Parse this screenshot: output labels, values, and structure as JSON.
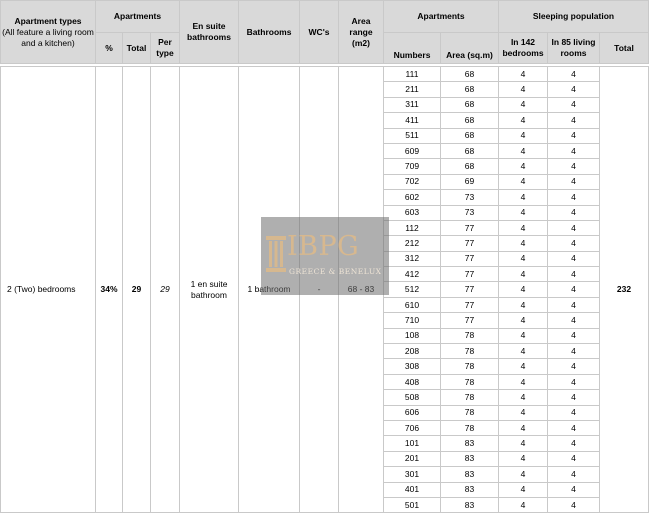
{
  "header": {
    "apartment_types": "Apartment types",
    "apartment_types_note": "(All feature a living room and a kitchen)",
    "apartments_group": "Apartments",
    "percent": "%",
    "total": "Total",
    "per_type": "Per type",
    "en_suite": "En suite bathrooms",
    "bathrooms": "Bathrooms",
    "wcs": "WC's",
    "area_range": "Area range (m2)",
    "apartments_list": "Apartments",
    "numbers": "Numbers",
    "area_sqm": "Area (sq.m)",
    "sleeping": "Sleeping population",
    "in_bedrooms": "In 142 bedrooms",
    "in_living": "In 85 living rooms",
    "sleep_total": "Total"
  },
  "group": {
    "type": "2 (Two) bedrooms",
    "percent": "34%",
    "total": "29",
    "per_type": "29",
    "en_suite": "1 en suite bathroom",
    "bathrooms": "1 bathroom",
    "wcs": "-",
    "area_range": "68 - 83",
    "sleep_total": "232"
  },
  "rows": [
    {
      "n": "111",
      "a": "68",
      "b": "4",
      "l": "4"
    },
    {
      "n": "211",
      "a": "68",
      "b": "4",
      "l": "4"
    },
    {
      "n": "311",
      "a": "68",
      "b": "4",
      "l": "4"
    },
    {
      "n": "411",
      "a": "68",
      "b": "4",
      "l": "4"
    },
    {
      "n": "511",
      "a": "68",
      "b": "4",
      "l": "4"
    },
    {
      "n": "609",
      "a": "68",
      "b": "4",
      "l": "4"
    },
    {
      "n": "709",
      "a": "68",
      "b": "4",
      "l": "4"
    },
    {
      "n": "702",
      "a": "69",
      "b": "4",
      "l": "4"
    },
    {
      "n": "602",
      "a": "73",
      "b": "4",
      "l": "4"
    },
    {
      "n": "603",
      "a": "73",
      "b": "4",
      "l": "4"
    },
    {
      "n": "112",
      "a": "77",
      "b": "4",
      "l": "4"
    },
    {
      "n": "212",
      "a": "77",
      "b": "4",
      "l": "4"
    },
    {
      "n": "312",
      "a": "77",
      "b": "4",
      "l": "4"
    },
    {
      "n": "412",
      "a": "77",
      "b": "4",
      "l": "4"
    },
    {
      "n": "512",
      "a": "77",
      "b": "4",
      "l": "4"
    },
    {
      "n": "610",
      "a": "77",
      "b": "4",
      "l": "4"
    },
    {
      "n": "710",
      "a": "77",
      "b": "4",
      "l": "4"
    },
    {
      "n": "108",
      "a": "78",
      "b": "4",
      "l": "4"
    },
    {
      "n": "208",
      "a": "78",
      "b": "4",
      "l": "4"
    },
    {
      "n": "308",
      "a": "78",
      "b": "4",
      "l": "4"
    },
    {
      "n": "408",
      "a": "78",
      "b": "4",
      "l": "4"
    },
    {
      "n": "508",
      "a": "78",
      "b": "4",
      "l": "4"
    },
    {
      "n": "606",
      "a": "78",
      "b": "4",
      "l": "4"
    },
    {
      "n": "706",
      "a": "78",
      "b": "4",
      "l": "4"
    },
    {
      "n": "101",
      "a": "83",
      "b": "4",
      "l": "4"
    },
    {
      "n": "201",
      "a": "83",
      "b": "4",
      "l": "4"
    },
    {
      "n": "301",
      "a": "83",
      "b": "4",
      "l": "4"
    },
    {
      "n": "401",
      "a": "83",
      "b": "4",
      "l": "4"
    },
    {
      "n": "501",
      "a": "83",
      "b": "4",
      "l": "4"
    }
  ],
  "watermark": {
    "logo": "IBPG",
    "tagline": "GREECE & BENELUX",
    "logo_color": "#dab98c",
    "box_color": "#6e6e6e"
  },
  "colors": {
    "header_bg": "#d9d9d9",
    "grid": "#c9c9c9"
  }
}
